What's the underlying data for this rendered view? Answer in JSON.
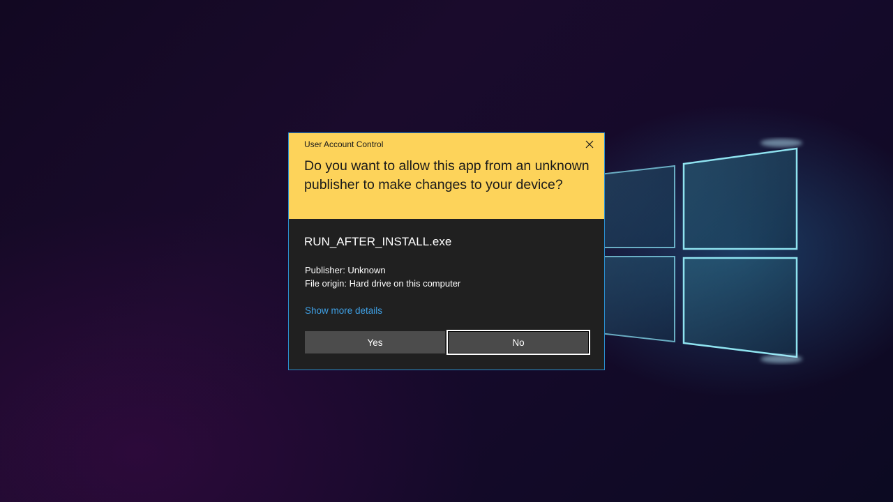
{
  "dialog": {
    "title": "User Account Control",
    "question": "Do you want to allow this app from an unknown publisher to make changes to your device?",
    "app_name": "RUN_AFTER_INSTALL.exe",
    "publisher_line": "Publisher: Unknown",
    "origin_line": "File origin: Hard drive on this computer",
    "details_link": "Show more details",
    "yes_label": "Yes",
    "no_label": "No",
    "close_icon": "close-icon"
  },
  "colors": {
    "header_bg": "#fdd35a",
    "body_bg": "#202020",
    "link": "#3fa1e6",
    "button_bg": "#4c4c4c",
    "dialog_border": "#2a8fd0"
  }
}
